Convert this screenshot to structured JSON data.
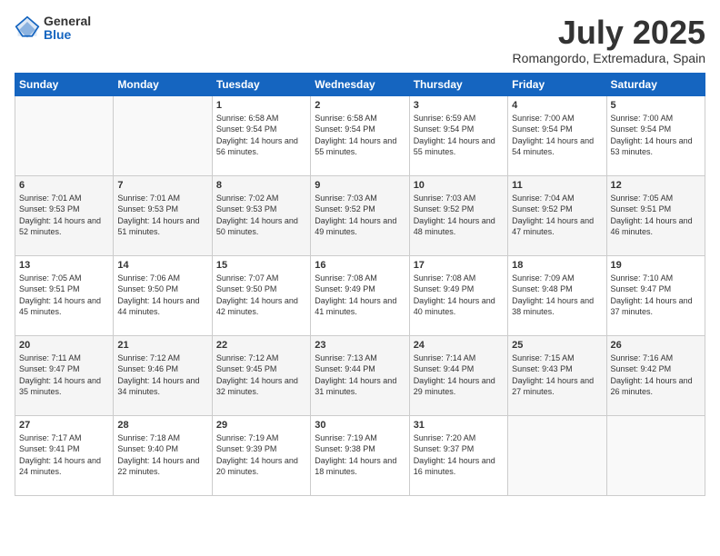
{
  "header": {
    "logo_general": "General",
    "logo_blue": "Blue",
    "month_title": "July 2025",
    "location": "Romangordo, Extremadura, Spain"
  },
  "days_of_week": [
    "Sunday",
    "Monday",
    "Tuesday",
    "Wednesday",
    "Thursday",
    "Friday",
    "Saturday"
  ],
  "weeks": [
    [
      {
        "day": "",
        "info": ""
      },
      {
        "day": "",
        "info": ""
      },
      {
        "day": "1",
        "info": "Sunrise: 6:58 AM\nSunset: 9:54 PM\nDaylight: 14 hours and 56 minutes."
      },
      {
        "day": "2",
        "info": "Sunrise: 6:58 AM\nSunset: 9:54 PM\nDaylight: 14 hours and 55 minutes."
      },
      {
        "day": "3",
        "info": "Sunrise: 6:59 AM\nSunset: 9:54 PM\nDaylight: 14 hours and 55 minutes."
      },
      {
        "day": "4",
        "info": "Sunrise: 7:00 AM\nSunset: 9:54 PM\nDaylight: 14 hours and 54 minutes."
      },
      {
        "day": "5",
        "info": "Sunrise: 7:00 AM\nSunset: 9:54 PM\nDaylight: 14 hours and 53 minutes."
      }
    ],
    [
      {
        "day": "6",
        "info": "Sunrise: 7:01 AM\nSunset: 9:53 PM\nDaylight: 14 hours and 52 minutes."
      },
      {
        "day": "7",
        "info": "Sunrise: 7:01 AM\nSunset: 9:53 PM\nDaylight: 14 hours and 51 minutes."
      },
      {
        "day": "8",
        "info": "Sunrise: 7:02 AM\nSunset: 9:53 PM\nDaylight: 14 hours and 50 minutes."
      },
      {
        "day": "9",
        "info": "Sunrise: 7:03 AM\nSunset: 9:52 PM\nDaylight: 14 hours and 49 minutes."
      },
      {
        "day": "10",
        "info": "Sunrise: 7:03 AM\nSunset: 9:52 PM\nDaylight: 14 hours and 48 minutes."
      },
      {
        "day": "11",
        "info": "Sunrise: 7:04 AM\nSunset: 9:52 PM\nDaylight: 14 hours and 47 minutes."
      },
      {
        "day": "12",
        "info": "Sunrise: 7:05 AM\nSunset: 9:51 PM\nDaylight: 14 hours and 46 minutes."
      }
    ],
    [
      {
        "day": "13",
        "info": "Sunrise: 7:05 AM\nSunset: 9:51 PM\nDaylight: 14 hours and 45 minutes."
      },
      {
        "day": "14",
        "info": "Sunrise: 7:06 AM\nSunset: 9:50 PM\nDaylight: 14 hours and 44 minutes."
      },
      {
        "day": "15",
        "info": "Sunrise: 7:07 AM\nSunset: 9:50 PM\nDaylight: 14 hours and 42 minutes."
      },
      {
        "day": "16",
        "info": "Sunrise: 7:08 AM\nSunset: 9:49 PM\nDaylight: 14 hours and 41 minutes."
      },
      {
        "day": "17",
        "info": "Sunrise: 7:08 AM\nSunset: 9:49 PM\nDaylight: 14 hours and 40 minutes."
      },
      {
        "day": "18",
        "info": "Sunrise: 7:09 AM\nSunset: 9:48 PM\nDaylight: 14 hours and 38 minutes."
      },
      {
        "day": "19",
        "info": "Sunrise: 7:10 AM\nSunset: 9:47 PM\nDaylight: 14 hours and 37 minutes."
      }
    ],
    [
      {
        "day": "20",
        "info": "Sunrise: 7:11 AM\nSunset: 9:47 PM\nDaylight: 14 hours and 35 minutes."
      },
      {
        "day": "21",
        "info": "Sunrise: 7:12 AM\nSunset: 9:46 PM\nDaylight: 14 hours and 34 minutes."
      },
      {
        "day": "22",
        "info": "Sunrise: 7:12 AM\nSunset: 9:45 PM\nDaylight: 14 hours and 32 minutes."
      },
      {
        "day": "23",
        "info": "Sunrise: 7:13 AM\nSunset: 9:44 PM\nDaylight: 14 hours and 31 minutes."
      },
      {
        "day": "24",
        "info": "Sunrise: 7:14 AM\nSunset: 9:44 PM\nDaylight: 14 hours and 29 minutes."
      },
      {
        "day": "25",
        "info": "Sunrise: 7:15 AM\nSunset: 9:43 PM\nDaylight: 14 hours and 27 minutes."
      },
      {
        "day": "26",
        "info": "Sunrise: 7:16 AM\nSunset: 9:42 PM\nDaylight: 14 hours and 26 minutes."
      }
    ],
    [
      {
        "day": "27",
        "info": "Sunrise: 7:17 AM\nSunset: 9:41 PM\nDaylight: 14 hours and 24 minutes."
      },
      {
        "day": "28",
        "info": "Sunrise: 7:18 AM\nSunset: 9:40 PM\nDaylight: 14 hours and 22 minutes."
      },
      {
        "day": "29",
        "info": "Sunrise: 7:19 AM\nSunset: 9:39 PM\nDaylight: 14 hours and 20 minutes."
      },
      {
        "day": "30",
        "info": "Sunrise: 7:19 AM\nSunset: 9:38 PM\nDaylight: 14 hours and 18 minutes."
      },
      {
        "day": "31",
        "info": "Sunrise: 7:20 AM\nSunset: 9:37 PM\nDaylight: 14 hours and 16 minutes."
      },
      {
        "day": "",
        "info": ""
      },
      {
        "day": "",
        "info": ""
      }
    ]
  ]
}
